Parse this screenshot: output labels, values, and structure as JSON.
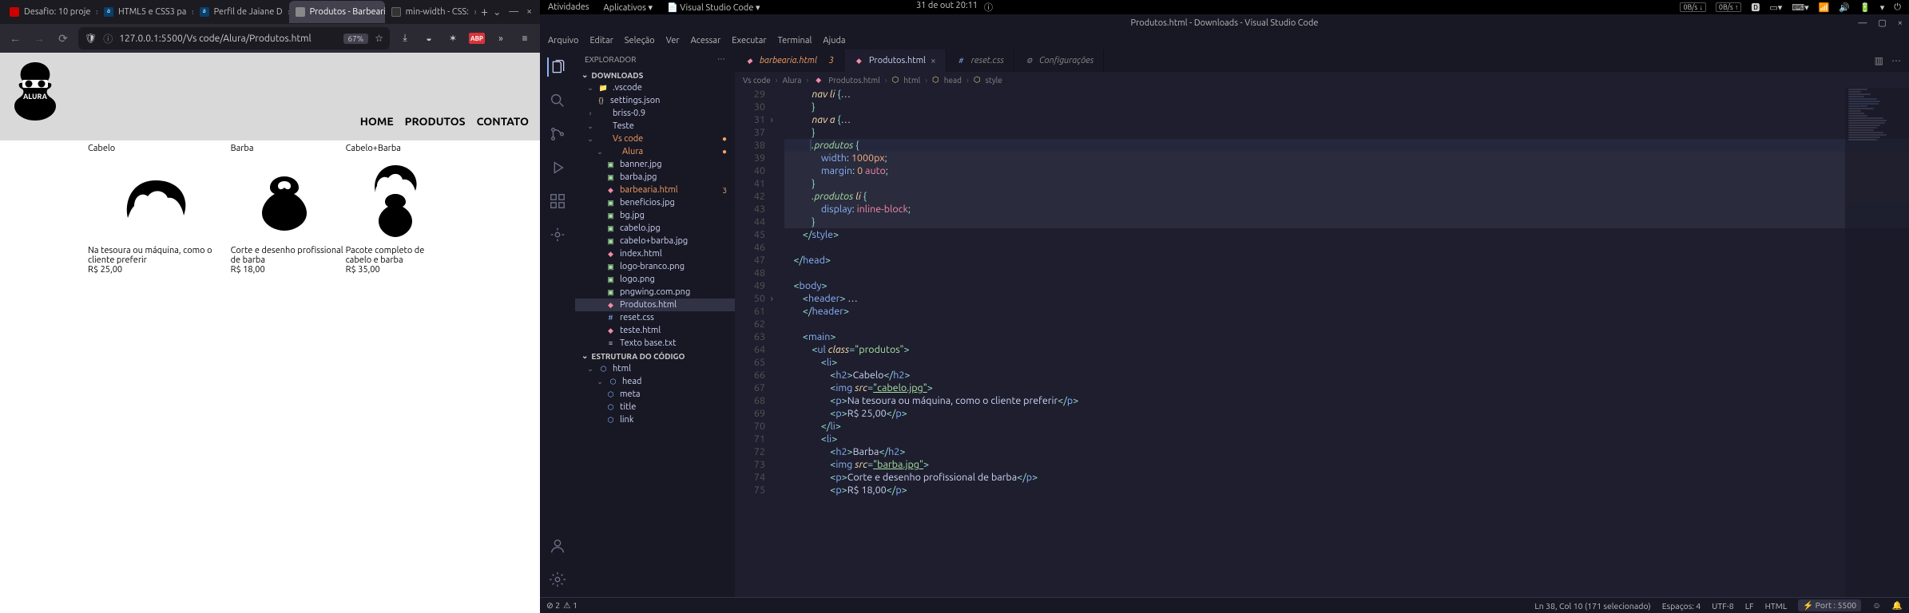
{
  "gnome": {
    "atividades": "Atividades",
    "aplicativos": "Aplicativos ▾",
    "app": "Visual Studio Code ▾",
    "date": "31 de out  20:11",
    "obs1": "0B/s ↓",
    "obs2": "0B/s ↑"
  },
  "firefox": {
    "tabs": [
      {
        "label": "Desafio: 10 proje",
        "fav": "#cc0000"
      },
      {
        "label": "HTML5 e CSS3 pa",
        "fav": "#083f6d"
      },
      {
        "label": "Perfil de Jaiane D",
        "fav": "#083f6d"
      },
      {
        "label": "Produtos - Barbeari",
        "fav": "#888"
      },
      {
        "label": "min-width - CSS:",
        "fav": "#333"
      }
    ],
    "url": "127.0.0.1:5500/Vs code/Alura/Produtos.html",
    "zoom": "67%",
    "nav": {
      "home": "HOME",
      "produtos": "PRODUTOS",
      "contato": "CONTATO"
    },
    "produtos": [
      {
        "title": "Cabelo",
        "desc": "Na tesoura ou máquina, como o cliente preferir",
        "price": "R$ 25,00"
      },
      {
        "title": "Barba",
        "desc": "Corte e desenho profissional de barba",
        "price": "R$ 18,00"
      },
      {
        "title": "Cabelo+Barba",
        "desc": "Pacote completo de cabelo e barba",
        "price": "R$ 35,00"
      }
    ],
    "logo_label": "ALURA"
  },
  "vscode": {
    "title": "Produtos.html - Downloads - Visual Studio Code",
    "menu": [
      "Arquivo",
      "Editar",
      "Seleção",
      "Ver",
      "Acessar",
      "Executar",
      "Terminal",
      "Ajuda"
    ],
    "explorer_label": "EXPLORADOR",
    "sections": {
      "downloads": "DOWNLOADS",
      "outline": "ESTRUTURA DO CÓDIGO"
    },
    "tree": {
      "vscode": ".vscode",
      "settings": "settings.json",
      "briss": "briss-0.9",
      "teste": "Teste",
      "vscode_folder": "Vs code",
      "alura": "Alura",
      "files": {
        "banner": "banner.jpg",
        "barba": "barba.jpg",
        "barbearia": "barbearia.html",
        "beneficios": "beneficios.jpg",
        "bg": "bg.jpg",
        "cabelo": "cabelo.jpg",
        "cabelobarba": "cabelo+barba.jpg",
        "index": "index.html",
        "logobranco": "logo-branco.png",
        "logo": "logo.png",
        "pngwing": "pngwing.com.png",
        "produtos": "Produtos.html",
        "reset": "reset.css",
        "testehtml": "teste.html",
        "textobase": "Texto base.txt"
      },
      "mod_badge": "3"
    },
    "outline": {
      "html": "html",
      "head": "head",
      "meta": "meta",
      "title": "title",
      "link": "link"
    },
    "tabs": {
      "barbearia": "barbearia.html",
      "barbearia_badge": "3",
      "produtos": "Produtos.html",
      "reset": "reset.css",
      "config": "Configurações"
    },
    "breadcrumb": [
      "Vs code",
      "Alura",
      "Produtos.html",
      "html",
      "head",
      "style"
    ],
    "status": {
      "errors": "⊘ 2",
      "warnings": "⚠ 1",
      "cursor": "Ln 38, Col 10 (171 selecionado)",
      "spaces": "Espaços: 4",
      "encoding": "UTF-8",
      "eol": "LF",
      "lang": "HTML",
      "port": "⚡ Port : 5500",
      "bell": "🔔"
    },
    "code_lines": [
      29,
      30,
      31,
      37,
      38,
      39,
      40,
      41,
      42,
      43,
      44,
      45,
      46,
      47,
      48,
      49,
      50,
      61,
      62,
      63,
      64,
      65,
      66,
      67,
      68,
      69,
      70,
      71,
      72,
      73,
      74,
      75
    ]
  },
  "chart_data": null
}
